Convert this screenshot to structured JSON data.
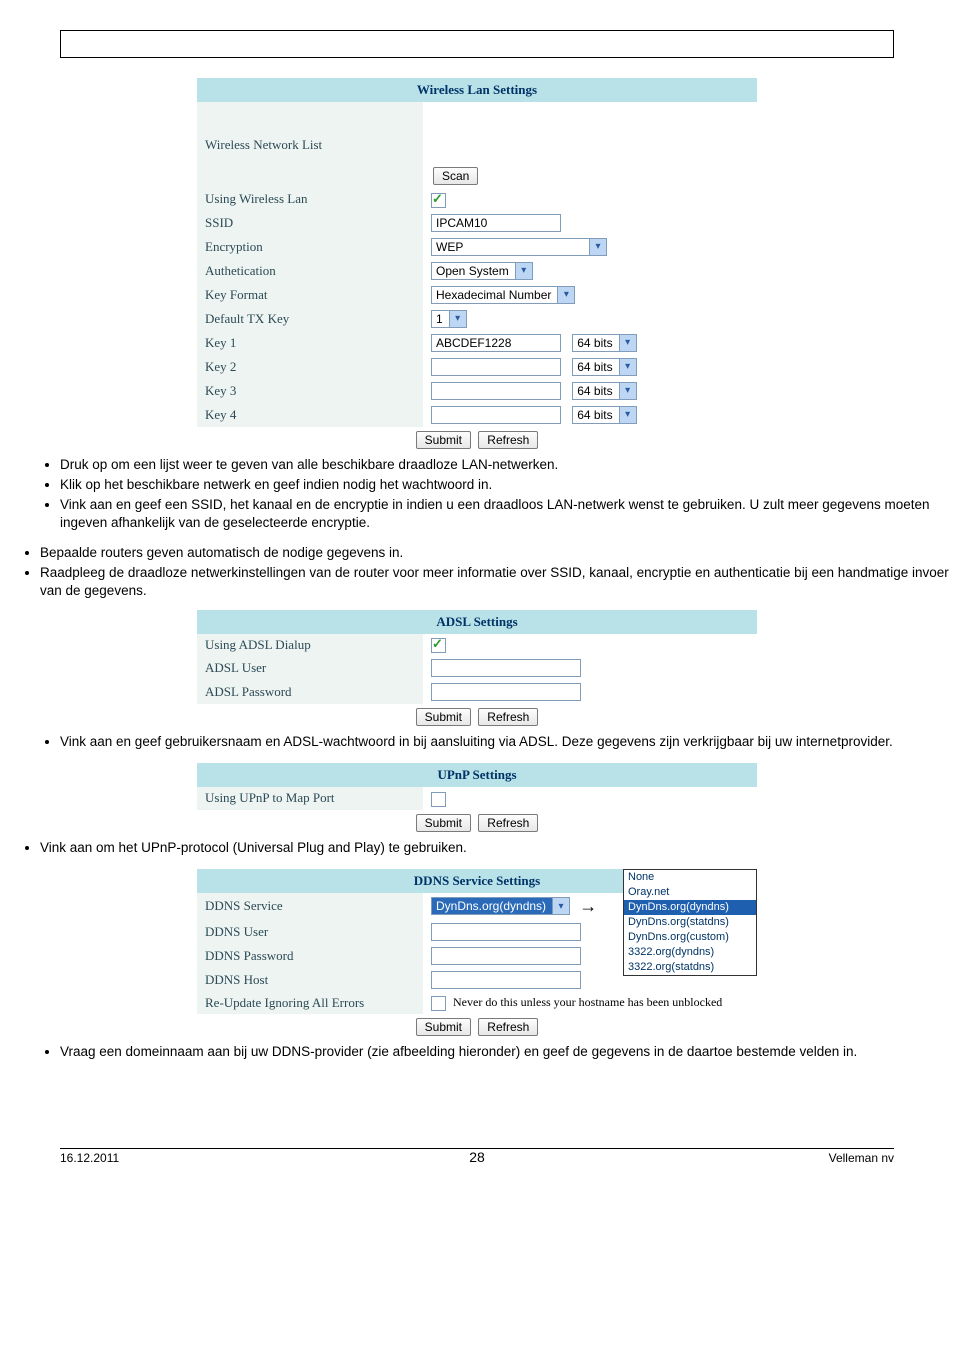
{
  "wireless": {
    "title": "Wireless Lan Settings",
    "network_list_label": "Wireless Network List",
    "scan": "Scan",
    "using_label": "Using Wireless Lan",
    "ssid_label": "SSID",
    "ssid_value": "IPCAM10",
    "encryption_label": "Encryption",
    "encryption_value": "WEP",
    "auth_label": "Authetication",
    "auth_value": "Open System",
    "keyformat_label": "Key Format",
    "keyformat_value": "Hexadecimal Number",
    "txkey_label": "Default TX Key",
    "txkey_value": "1",
    "key1_label": "Key 1",
    "key1_value": "ABCDEF1228",
    "key2_label": "Key 2",
    "key3_label": "Key 3",
    "key4_label": "Key 4",
    "bits": "64 bits",
    "submit": "Submit",
    "refresh": "Refresh"
  },
  "text": {
    "b1": "Druk op            om een lijst weer te geven van alle beschikbare draadloze LAN-netwerken.",
    "b2": "Klik op het beschikbare netwerk en geef indien nodig het wachtwoord in.",
    "b3a": "Vink                                   aan en geef een SSID, het kanaal en de encryptie in indien u een draadloos LAN-netwerk wenst te gebruiken. U zult meer gegevens moeten ingeven afhankelijk van de geselecteerde encryptie.",
    "i1": "Bepaalde routers geven automatisch de nodige gegevens in.",
    "i2": "Raadpleeg de draadloze netwerkinstellingen van de router voor meer informatie over SSID, kanaal, encryptie en authenticatie bij een handmatige invoer van de gegevens.",
    "b4": "Vink aan en geef gebruikersnaam en ADSL-wachtwoord in bij aansluiting via ADSL. Deze gegevens zijn verkrijgbaar bij uw internetprovider.",
    "b5": "Vink aan om het UPnP-protocol (Universal Plug and Play) te gebruiken.",
    "b6": "Vraag een domeinnaam aan bij uw DDNS-provider (zie afbeelding hieronder) en geef de gegevens in de daartoe bestemde velden in."
  },
  "adsl": {
    "title": "ADSL Settings",
    "using_label": "Using ADSL Dialup",
    "user_label": "ADSL User",
    "pass_label": "ADSL Password",
    "submit": "Submit",
    "refresh": "Refresh"
  },
  "upnp": {
    "title": "UPnP Settings",
    "using_label": "Using UPnP to Map Port",
    "submit": "Submit",
    "refresh": "Refresh"
  },
  "ddns": {
    "title": "DDNS Service Settings",
    "service_label": "DDNS Service",
    "service_value": "DynDns.org(dyndns)",
    "user_label": "DDNS User",
    "pass_label": "DDNS Password",
    "host_label": "DDNS Host",
    "reupdate_label": "Re-Update Ignoring All Errors",
    "reupdate_note": "Never do this unless your hostname has been unblocked",
    "submit": "Submit",
    "refresh": "Refresh",
    "options": [
      "None",
      "Oray.net",
      "DynDns.org(dyndns)",
      "DynDns.org(statdns)",
      "DynDns.org(custom)",
      "3322.org(dyndns)",
      "3322.org(statdns)"
    ]
  },
  "footer": {
    "date": "16.12.2011",
    "page": "28",
    "company": "Velleman nv"
  }
}
